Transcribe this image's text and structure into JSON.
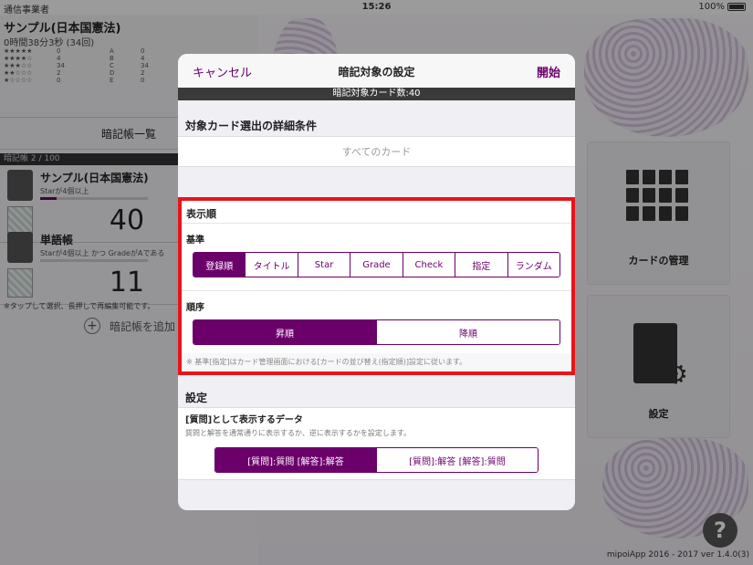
{
  "status_bar": {
    "carrier": "通信事業者",
    "time": "15:26",
    "battery": "100%"
  },
  "background": {
    "deck_title": "サンプル(日本国憲法)",
    "deck_time": "0時間38分3秒 (34回)",
    "star_rows": [
      {
        "stars": "★★★★★",
        "star_count": "0",
        "grade": "A",
        "grade_count": "0"
      },
      {
        "stars": "★★★★☆",
        "star_count": "4",
        "grade": "B",
        "grade_count": "4"
      },
      {
        "stars": "★★★☆☆",
        "star_count": "34",
        "grade": "C",
        "grade_count": "34"
      },
      {
        "stars": "★★☆☆☆",
        "star_count": "2",
        "grade": "D",
        "grade_count": "2"
      },
      {
        "stars": "★☆☆☆☆",
        "star_count": "0",
        "grade": "E",
        "grade_count": "0"
      }
    ],
    "list_header": "暗記帳一覧",
    "deck_count": "暗記帳 2 / 100",
    "decks": [
      {
        "name": "サンプル(日本国憲法)",
        "condition": "Starが4個以上",
        "count": "40",
        "progress": 0.15
      },
      {
        "name": "単語帳",
        "condition": "Starが4個以上 かつ GradeがAである",
        "count": "11",
        "progress": 0.0
      }
    ],
    "tap_note": "※タップして選択、長押しで再編集可能です。",
    "add_deck_label": "暗記帳を追加",
    "tiles": {
      "card_manage": "カードの管理",
      "settings": "設定"
    },
    "copyright": "mipoiApp 2016 - 2017 ver 1.4.0(3)"
  },
  "modal": {
    "cancel_label": "キャンセル",
    "title": "暗記対象の設定",
    "start_label": "開始",
    "card_count": "暗記対象カード数:40",
    "filter_section": "対象カード選出の詳細条件",
    "all_cards": "すべてのカード",
    "order_section": "表示順",
    "basis_label": "基準",
    "basis_options": [
      "登録順",
      "タイトル",
      "Star",
      "Grade",
      "Check",
      "指定",
      "ランダム"
    ],
    "basis_selected": 0,
    "sequence_label": "順序",
    "sequence_options": [
      "昇順",
      "降順"
    ],
    "sequence_selected": 0,
    "order_note": "※ 基準[指定]はカード管理画面における[カードの並び替え(指定順)]設定に従います。",
    "settings_section": "設定",
    "question_data_title": "[質問]として表示するデータ",
    "question_data_desc": "質問と解答を通常通りに表示するか、逆に表示するかを設定します。",
    "question_options": [
      "[質問]:質問 [解答]:解答",
      "[質問]:解答 [解答]:質問"
    ],
    "question_selected": 0
  }
}
